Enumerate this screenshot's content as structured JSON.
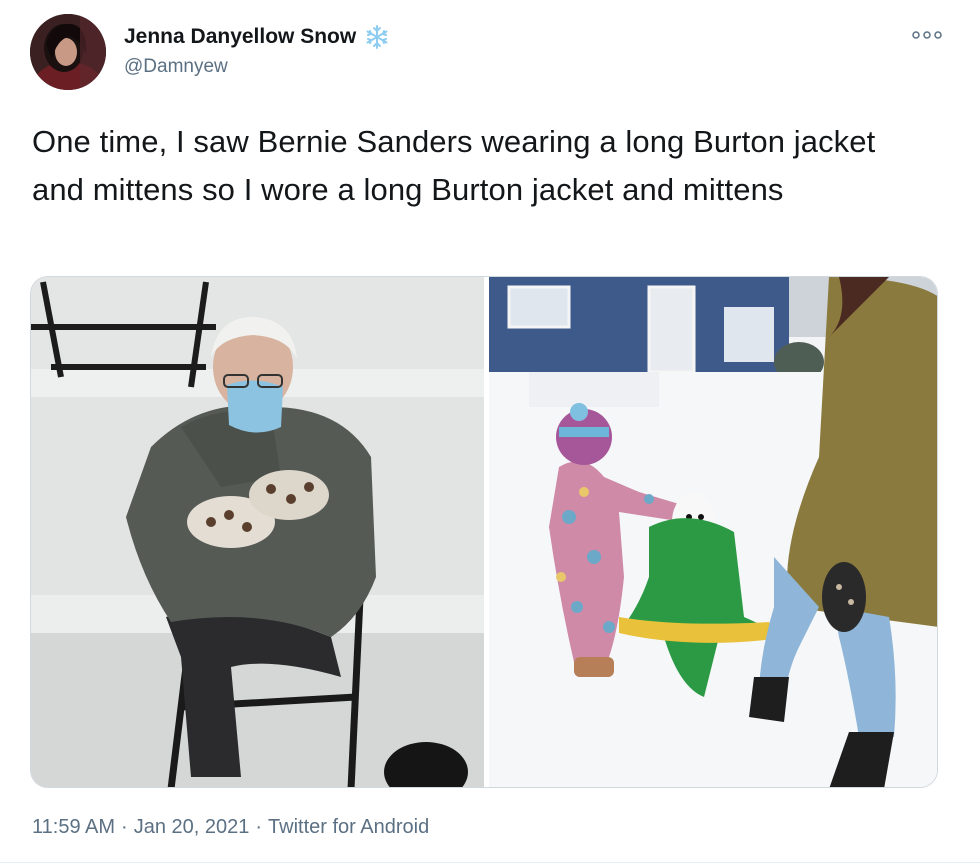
{
  "author": {
    "name": "Jenna Danyellow Snow",
    "handle": "@Damnyew",
    "name_emoji_icon": "snowflake-icon"
  },
  "tweet": {
    "text": "One time, I saw Bernie Sanders wearing a long Burton jacket and mittens so I wore a long Burton jacket and mittens"
  },
  "media": [
    {
      "subject": "bernie-sanders-photo"
    },
    {
      "subject": "child-snowman-photo"
    }
  ],
  "meta": {
    "time": "11:59 AM",
    "separator": "·",
    "date": "Jan 20, 2021",
    "source": "Twitter for Android"
  },
  "colors": {
    "text": "#14171a",
    "secondary": "#5b7083",
    "border": "#cfd9de",
    "snowflake": "#8ecdf0"
  }
}
